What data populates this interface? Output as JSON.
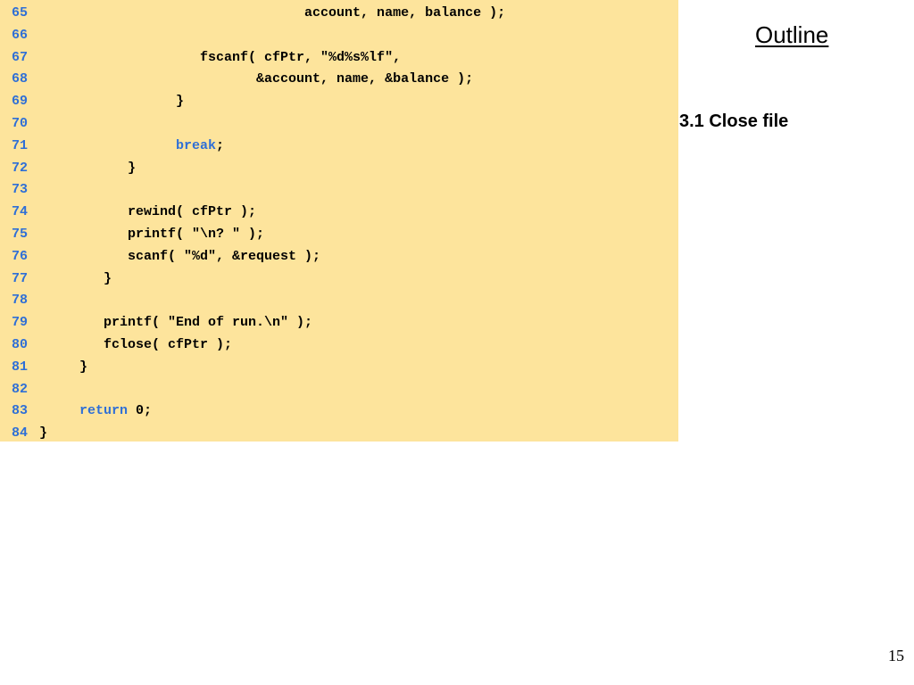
{
  "outline": {
    "title": "Outline"
  },
  "section": {
    "label": "3.1 Close file"
  },
  "page": {
    "number": "15"
  },
  "colors": {
    "panel": "#fde49c",
    "line_number": "#2f6fd6",
    "keyword": "#2f6fd6",
    "text": "#000000"
  },
  "code": {
    "lines": [
      {
        "num": "65",
        "text": "                                 account, name, balance );",
        "keyword": ""
      },
      {
        "num": "66",
        "text": "",
        "keyword": ""
      },
      {
        "num": "67",
        "text": "                    fscanf( cfPtr, \"%d%s%lf\",",
        "keyword": ""
      },
      {
        "num": "68",
        "text": "                           &account, name, &balance );",
        "keyword": ""
      },
      {
        "num": "69",
        "text": "                 }",
        "keyword": ""
      },
      {
        "num": "70",
        "text": "",
        "keyword": ""
      },
      {
        "num": "71",
        "text": "                 ",
        "keyword": "break",
        "after": ";"
      },
      {
        "num": "72",
        "text": "           }",
        "keyword": ""
      },
      {
        "num": "73",
        "text": "",
        "keyword": ""
      },
      {
        "num": "74",
        "text": "           rewind( cfPtr );",
        "keyword": ""
      },
      {
        "num": "75",
        "text": "           printf( \"\\n? \" );",
        "keyword": ""
      },
      {
        "num": "76",
        "text": "           scanf( \"%d\", &request );",
        "keyword": ""
      },
      {
        "num": "77",
        "text": "        }",
        "keyword": ""
      },
      {
        "num": "78",
        "text": "",
        "keyword": ""
      },
      {
        "num": "79",
        "text": "        printf( \"End of run.\\n\" );",
        "keyword": ""
      },
      {
        "num": "80",
        "text": "        fclose( cfPtr );",
        "keyword": ""
      },
      {
        "num": "81",
        "text": "     }",
        "keyword": ""
      },
      {
        "num": "82",
        "text": "",
        "keyword": ""
      },
      {
        "num": "83",
        "text": "     ",
        "keyword": "return",
        "after": " 0;"
      },
      {
        "num": "84",
        "text": "}",
        "keyword": ""
      }
    ]
  }
}
